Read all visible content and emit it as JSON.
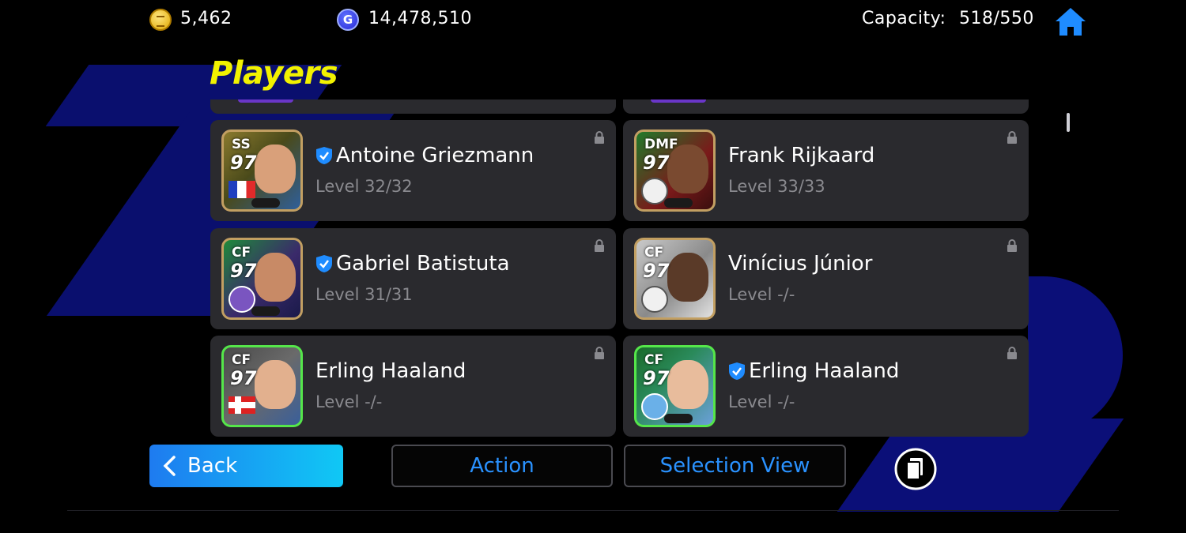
{
  "topbar": {
    "ecoins": "5,462",
    "gp": "14,478,510",
    "gp_glyph": "G",
    "capacity_label": "Capacity:",
    "capacity_value": "518/550"
  },
  "title": "Players",
  "players": [
    {
      "position": "SS",
      "rating": "97",
      "name": "Antoine Griezmann",
      "level": "Level 32/32",
      "verified": true
    },
    {
      "position": "DMF",
      "rating": "97",
      "name": "Frank Rijkaard",
      "level": "Level 33/33",
      "verified": false
    },
    {
      "position": "CF",
      "rating": "97",
      "name": "Gabriel Batistuta",
      "level": "Level 31/31",
      "verified": true
    },
    {
      "position": "CF",
      "rating": "97",
      "name": "Vinícius Júnior",
      "level": "Level -/-",
      "verified": false
    },
    {
      "position": "CF",
      "rating": "97",
      "name": "Erling Haaland",
      "level": "Level -/-",
      "verified": false
    },
    {
      "position": "CF",
      "rating": "97",
      "name": "Erling Haaland",
      "level": "Level -/-",
      "verified": true
    }
  ],
  "buttons": {
    "back": "Back",
    "action": "Action",
    "selection_view": "Selection View"
  },
  "colors": {
    "title_yellow": "#f2f200",
    "accent_blue": "#2a92ff",
    "card_bg": "#2a2a2e"
  }
}
